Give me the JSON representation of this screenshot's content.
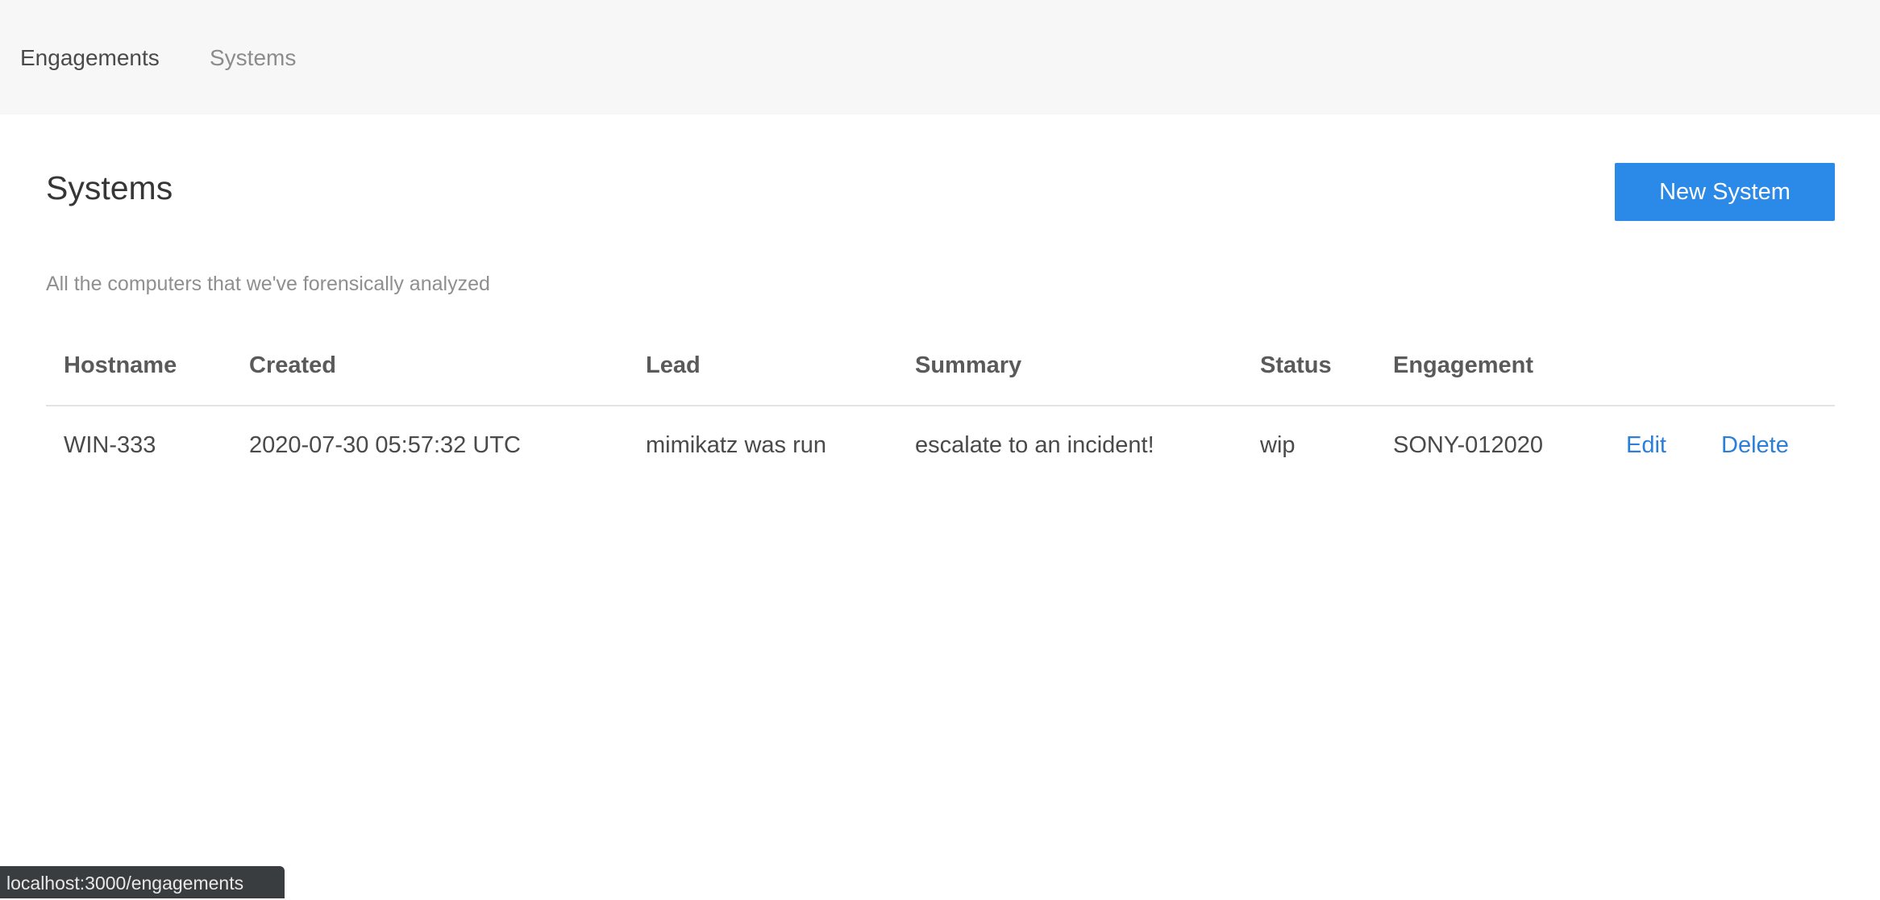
{
  "nav": {
    "items": [
      {
        "label": "Engagements",
        "active": true
      },
      {
        "label": "Systems",
        "active": false
      }
    ]
  },
  "page": {
    "title": "Systems",
    "new_button_label": "New System",
    "subtitle": "All the computers that we've forensically analyzed"
  },
  "table": {
    "headers": [
      "Hostname",
      "Created",
      "Lead",
      "Summary",
      "Status",
      "Engagement"
    ],
    "rows": [
      {
        "hostname": "WIN-333",
        "created": "2020-07-30 05:57:32 UTC",
        "lead": "mimikatz was run",
        "summary": "escalate to an incident!",
        "status": "wip",
        "engagement": "SONY-012020",
        "edit_label": "Edit",
        "delete_label": "Delete"
      }
    ]
  },
  "status_bar": {
    "url": "localhost:3000/engagements"
  },
  "colors": {
    "accent": "#2b89e8",
    "link": "#2b7fd8",
    "nav_bg": "#f7f7f7"
  }
}
